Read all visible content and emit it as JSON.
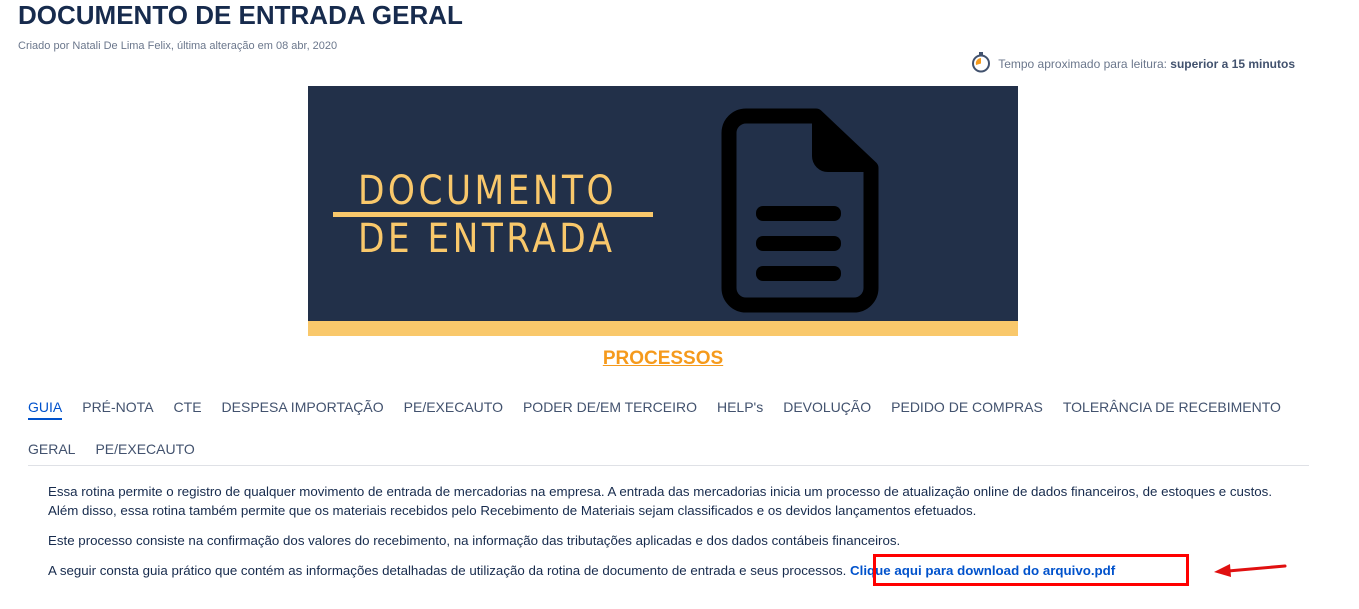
{
  "page": {
    "title": "DOCUMENTO DE ENTRADA GERAL",
    "meta": "Criado por Natali De Lima Felix, última alteração em 08 abr, 2020",
    "reading_label": "Tempo aproximado para leitura: ",
    "reading_value": "superior a 15 minutos"
  },
  "banner": {
    "line1": "DOCUMENTO",
    "line2": "DE ENTRADA",
    "icon": "document-icon"
  },
  "section_heading": "PROCESSOS",
  "tabs": [
    {
      "label": "GUIA",
      "active": true
    },
    {
      "label": "PRÉ-NOTA"
    },
    {
      "label": "CTE"
    },
    {
      "label": "DESPESA IMPORTAÇÃO"
    },
    {
      "label": "PE/EXECAUTO"
    },
    {
      "label": "PODER DE/EM TERCEIRO"
    },
    {
      "label": "HELP's"
    },
    {
      "label": "DEVOLUÇÃO"
    },
    {
      "label": "PEDIDO DE COMPRAS"
    },
    {
      "label": "TOLERÂNCIA DE RECEBIMENTO"
    },
    {
      "label": "GERAL"
    },
    {
      "label": "PE/EXECAUTO"
    }
  ],
  "content": {
    "p1": "Essa rotina permite o registro de qualquer movimento de entrada de mercadorias na empresa. A entrada das mercadorias inicia um processo de atualização online de dados financeiros, de estoques e custos. Além disso, essa rotina também permite que os materiais recebidos pelo Recebimento de Materiais sejam classificados e os devidos lançamentos efetuados.",
    "p2": "Este processo consiste na confirmação dos valores do recebimento, na informação das tributações aplicadas e dos dados contábeis financeiros.",
    "p3": "A seguir consta guia prático que contém as informações detalhadas de utilização da rotina de documento de entrada e seus processos.",
    "link": "Clique aqui para download do arquivo.pdf"
  },
  "colors": {
    "banner_bg": "#223049",
    "banner_accent": "#f9c86b",
    "heading": "#f59a1c",
    "link": "#0052cc",
    "highlight": "#ff0000"
  }
}
